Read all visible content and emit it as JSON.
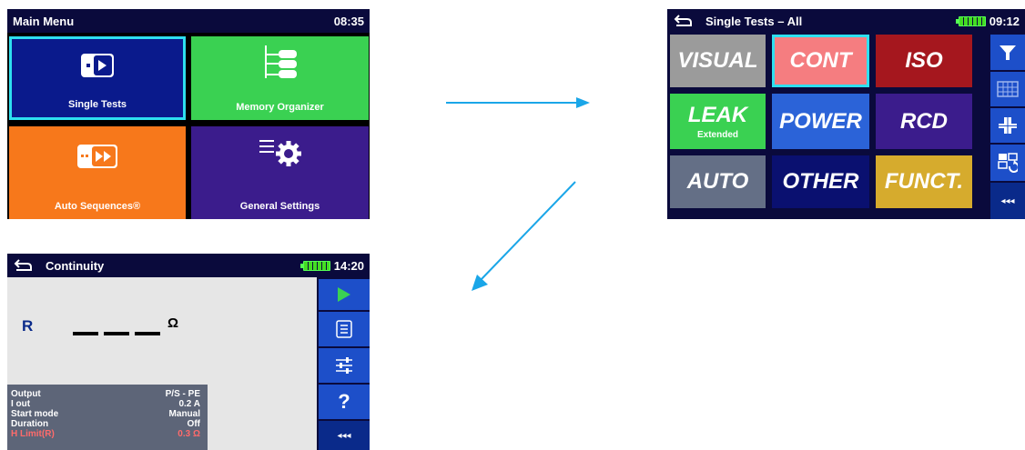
{
  "main_menu": {
    "title": "Main Menu",
    "time": "08:35",
    "tiles": {
      "single_tests": "Single Tests",
      "memory_organizer": "Memory Organizer",
      "auto_sequences": "Auto Sequences®",
      "general_settings": "General Settings"
    }
  },
  "single_tests": {
    "title": "Single Tests – All",
    "time": "09:12",
    "categories": {
      "visual": "VISUAL",
      "cont": "CONT",
      "iso": "ISO",
      "leak": "LEAK",
      "leak_sub": "Extended",
      "power": "POWER",
      "rcd": "RCD",
      "auto": "AUTO",
      "other": "OTHER",
      "funct": "FUNCT."
    },
    "more": "◂◂◂"
  },
  "continuity": {
    "title": "Continuity",
    "time": "14:20",
    "result_label": "R",
    "result_value": "_ _ _",
    "result_unit": "Ω",
    "help": "?",
    "more": "◂◂◂",
    "params": [
      {
        "name": "Output",
        "value": "P/S - PE"
      },
      {
        "name": "I out",
        "value": "0.2 A"
      },
      {
        "name": "Start mode",
        "value": "Manual"
      },
      {
        "name": "Duration",
        "value": "Off"
      },
      {
        "name": "H Limit(R)",
        "value": "0.3 Ω"
      }
    ]
  },
  "colors": {
    "header": "#0a0a3c",
    "accent_blue": "#1d4fc9",
    "highlight": "#2ee0f0",
    "arrow": "#1aa6e8"
  }
}
